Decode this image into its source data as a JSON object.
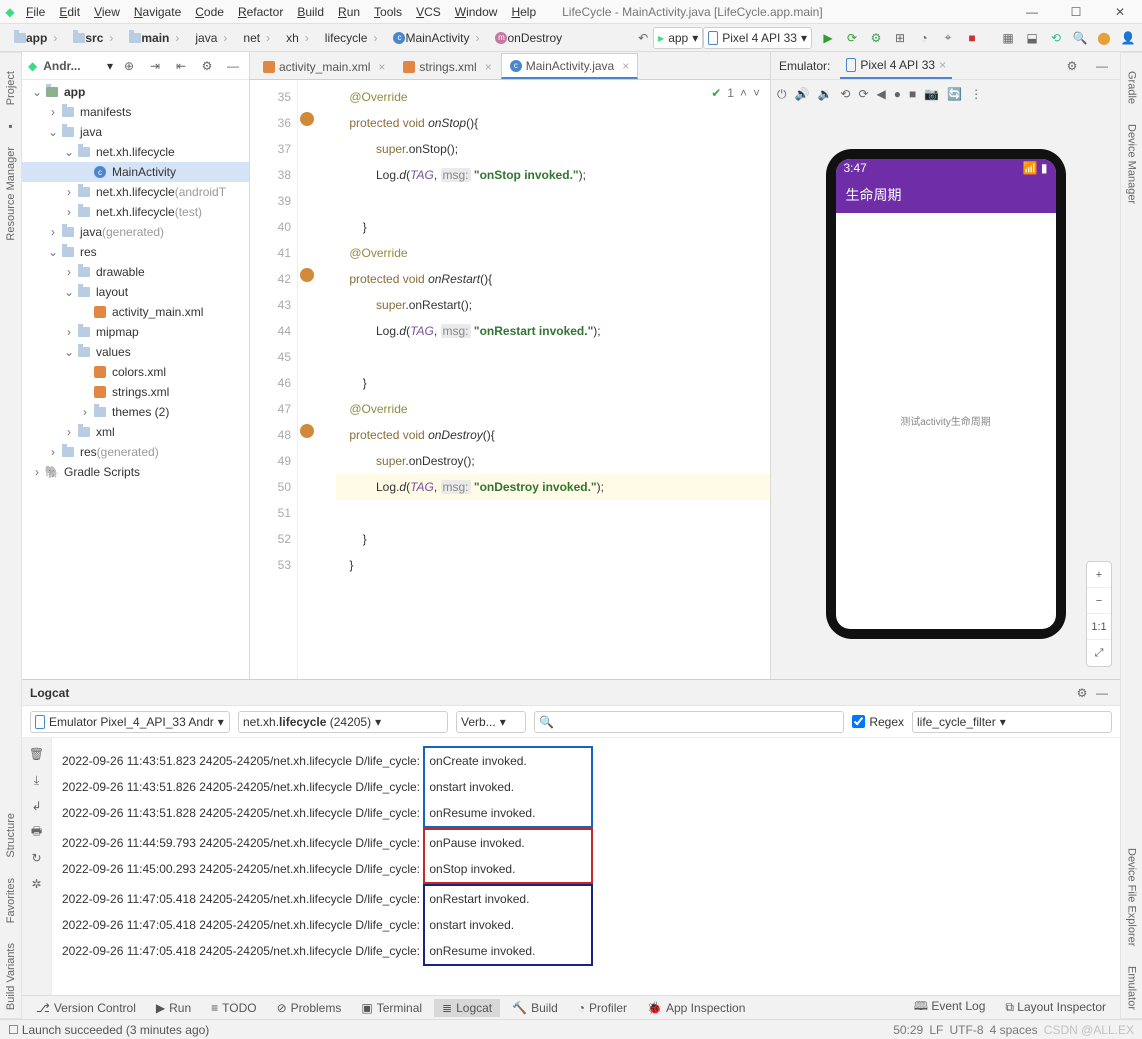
{
  "window": {
    "title": "LifeCycle - MainActivity.java [LifeCycle.app.main]"
  },
  "menus": [
    "File",
    "Edit",
    "View",
    "Navigate",
    "Code",
    "Refactor",
    "Build",
    "Run",
    "Tools",
    "VCS",
    "Window",
    "Help"
  ],
  "crumbs": [
    "app",
    "src",
    "main",
    "java",
    "net",
    "xh",
    "lifecycle",
    "MainActivity",
    "onDestroy"
  ],
  "run_config": "app",
  "device_combo": "Pixel 4 API 33",
  "project": {
    "title": "Andr...",
    "tree": [
      {
        "d": 0,
        "a": "v",
        "t": "app",
        "ic": "mod",
        "bold": true
      },
      {
        "d": 1,
        "a": ">",
        "t": "manifests",
        "ic": "folder"
      },
      {
        "d": 1,
        "a": "v",
        "t": "java",
        "ic": "folder"
      },
      {
        "d": 2,
        "a": "v",
        "t": "net.xh.lifecycle",
        "ic": "pkg"
      },
      {
        "d": 3,
        "a": "",
        "t": "MainActivity",
        "ic": "c",
        "sel": true
      },
      {
        "d": 2,
        "a": ">",
        "t": "net.xh.lifecycle",
        "suf": "(androidT",
        "ic": "pkg"
      },
      {
        "d": 2,
        "a": ">",
        "t": "net.xh.lifecycle",
        "suf": "(test)",
        "ic": "pkg"
      },
      {
        "d": 1,
        "a": ">",
        "t": "java",
        "suf": "(generated)",
        "ic": "gen"
      },
      {
        "d": 1,
        "a": "v",
        "t": "res",
        "ic": "folder"
      },
      {
        "d": 2,
        "a": ">",
        "t": "drawable",
        "ic": "folder"
      },
      {
        "d": 2,
        "a": "v",
        "t": "layout",
        "ic": "folder"
      },
      {
        "d": 3,
        "a": "",
        "t": "activity_main.xml",
        "ic": "xml"
      },
      {
        "d": 2,
        "a": ">",
        "t": "mipmap",
        "ic": "folder"
      },
      {
        "d": 2,
        "a": "v",
        "t": "values",
        "ic": "folder"
      },
      {
        "d": 3,
        "a": "",
        "t": "colors.xml",
        "ic": "xml"
      },
      {
        "d": 3,
        "a": "",
        "t": "strings.xml",
        "ic": "xml"
      },
      {
        "d": 3,
        "a": ">",
        "t": "themes (2)",
        "ic": "folder"
      },
      {
        "d": 2,
        "a": ">",
        "t": "xml",
        "ic": "folder"
      },
      {
        "d": 1,
        "a": ">",
        "t": "res",
        "suf": "(generated)",
        "ic": "gen"
      },
      {
        "d": 0,
        "a": ">",
        "t": "Gradle Scripts",
        "ic": "gradle"
      }
    ]
  },
  "editor_tabs": [
    {
      "label": "activity_main.xml",
      "ic": "xml"
    },
    {
      "label": "strings.xml",
      "ic": "xml"
    },
    {
      "label": "MainActivity.java",
      "ic": "c",
      "active": true
    }
  ],
  "inspections": "1",
  "gutter": {
    "start": 35,
    "end": 53,
    "overrides": [
      36,
      42,
      48
    ],
    "current": 50
  },
  "code": {
    "l35": "@Override",
    "l36": {
      "pre": "protected void ",
      "fn": "onStop",
      "post": "(){"
    },
    "l37": "        super.onStop();",
    "l38": {
      "pre": "        Log.",
      "d": "d",
      "open": "(",
      "tag": "TAG",
      "p": "msg:",
      "str": "\"onStop invoked.\"",
      "close": ");"
    },
    "l39": "",
    "l40": "    }",
    "l41": "@Override",
    "l42": {
      "pre": "protected void ",
      "fn": "onRestart",
      "post": "(){"
    },
    "l43": "        super.onRestart();",
    "l44": {
      "pre": "        Log.",
      "d": "d",
      "open": "(",
      "tag": "TAG",
      "p": "msg:",
      "str": "\"onRestart invoked.\"",
      "close": ");"
    },
    "l45": "",
    "l46": "    }",
    "l47": "@Override",
    "l48": {
      "pre": "protected void ",
      "fn": "onDestroy",
      "post": "(){"
    },
    "l49": "        super.onDestroy();",
    "l50": {
      "pre": "        Log.",
      "d": "d",
      "open": "(",
      "tag": "TAG",
      "p": "msg:",
      "str": "\"onDestroy invoked.\"",
      "close": ");"
    },
    "l51": "",
    "l52": "    }",
    "l53": "}"
  },
  "emulator": {
    "label": "Emulator:",
    "tab": "Pixel 4 API 33",
    "status_time": "3:47",
    "app_title": "生命周期",
    "body_text": "测试activity生命周期"
  },
  "logcat": {
    "title": "Logcat",
    "device": "Emulator Pixel_4_API_33 Andr",
    "process": "net.xh.lifecycle (24205)",
    "level": "Verb...",
    "regex": "Regex",
    "filter": "life_cycle_filter",
    "lines": [
      {
        "pre": "2022-09-26 11:43:51.823 24205-24205/net.xh.lifecycle D/life_cycle: ",
        "msg": "onCreate invoked.",
        "c": "blue",
        "t": "top"
      },
      {
        "pre": "2022-09-26 11:43:51.826 24205-24205/net.xh.lifecycle D/life_cycle: ",
        "msg": "onstart invoked. ",
        "c": "blue",
        "t": "mid"
      },
      {
        "pre": "2022-09-26 11:43:51.828 24205-24205/net.xh.lifecycle D/life_cycle: ",
        "msg": "onResume invoked.",
        "c": "blue",
        "t": "bot"
      },
      {
        "pre": "2022-09-26 11:44:59.793 24205-24205/net.xh.lifecycle D/life_cycle: ",
        "msg": "onPause invoked.    ",
        "c": "red",
        "t": "top"
      },
      {
        "pre": "2022-09-26 11:45:00.293 24205-24205/net.xh.lifecycle D/life_cycle: ",
        "msg": "onStop invoked.     ",
        "c": "red",
        "t": "bot"
      },
      {
        "pre": "2022-09-26 11:47:05.418 24205-24205/net.xh.lifecycle D/life_cycle: ",
        "msg": "onRestart invoked.",
        "c": "navy",
        "t": "top"
      },
      {
        "pre": "2022-09-26 11:47:05.418 24205-24205/net.xh.lifecycle D/life_cycle: ",
        "msg": "onstart invoked.  ",
        "c": "navy",
        "t": "mid"
      },
      {
        "pre": "2022-09-26 11:47:05.418 24205-24205/net.xh.lifecycle D/life_cycle: ",
        "msg": "onResume invoked. ",
        "c": "navy",
        "t": "bot"
      }
    ]
  },
  "bottom_tools": [
    "Version Control",
    "Run",
    "TODO",
    "Problems",
    "Terminal",
    "Logcat",
    "Build",
    "Profiler",
    "App Inspection"
  ],
  "bottom_right": [
    "Event Log",
    "Layout Inspector"
  ],
  "status": {
    "msg": "Launch succeeded (3 minutes ago)",
    "pos": "50:29",
    "lf": "LF",
    "enc": "UTF-8",
    "sp": "4 spaces",
    "wm": "CSDN @ALL.EX"
  },
  "left_labels": [
    "Project",
    "Resource Manager"
  ],
  "left_bot_labels": [
    "Structure",
    "Favorites",
    "Build Variants"
  ],
  "right_labels": [
    "Gradle",
    "Device Manager"
  ],
  "right_bot_labels": [
    "Device File Explorer",
    "Emulator"
  ]
}
